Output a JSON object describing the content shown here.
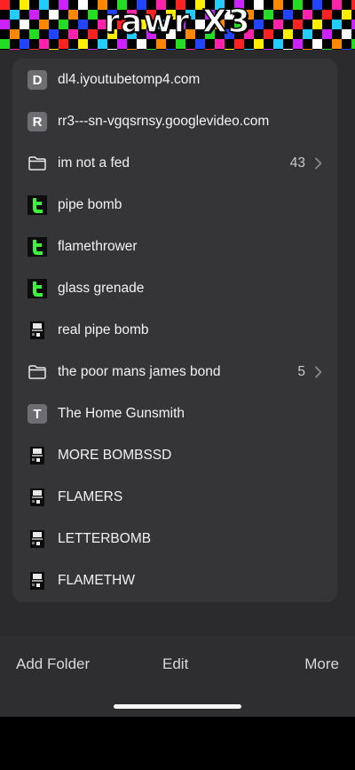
{
  "header": {
    "brand": "rawr X3"
  },
  "list": {
    "items": [
      {
        "icon": "letter-tile-icon",
        "icon_letter": "D",
        "label": "dl4.iyoutubetomp4.com"
      },
      {
        "icon": "letter-tile-icon",
        "icon_letter": "R",
        "label": "rr3---sn-vgqsrnsy.googlevideo.com"
      },
      {
        "icon": "folder-icon",
        "label": "im not a fed",
        "count": "43"
      },
      {
        "icon": "green-t-icon",
        "label": "pipe bomb"
      },
      {
        "icon": "green-t-icon",
        "label": "flamethrower"
      },
      {
        "icon": "green-t-icon",
        "label": "glass grenade"
      },
      {
        "icon": "document-icon",
        "label": "real pipe bomb"
      },
      {
        "icon": "folder-icon",
        "label": "the poor mans james bond",
        "count": "5"
      },
      {
        "icon": "letter-tile-icon",
        "icon_letter": "T",
        "label": "The Home Gunsmith"
      },
      {
        "icon": "document-icon",
        "label": "MORE BOMBSSD"
      },
      {
        "icon": "document-icon",
        "label": "FLAMERS"
      },
      {
        "icon": "document-icon",
        "label": "LETTERBOMB"
      },
      {
        "icon": "document-icon",
        "label": "FLAMETHW"
      }
    ]
  },
  "toolbar": {
    "add_folder": "Add Folder",
    "edit": "Edit",
    "more": "More"
  },
  "colors": {
    "background": "#2b2b2e",
    "card": "#353538",
    "accent_green": "#3df53d",
    "letter_tile": "#6d6d72"
  }
}
